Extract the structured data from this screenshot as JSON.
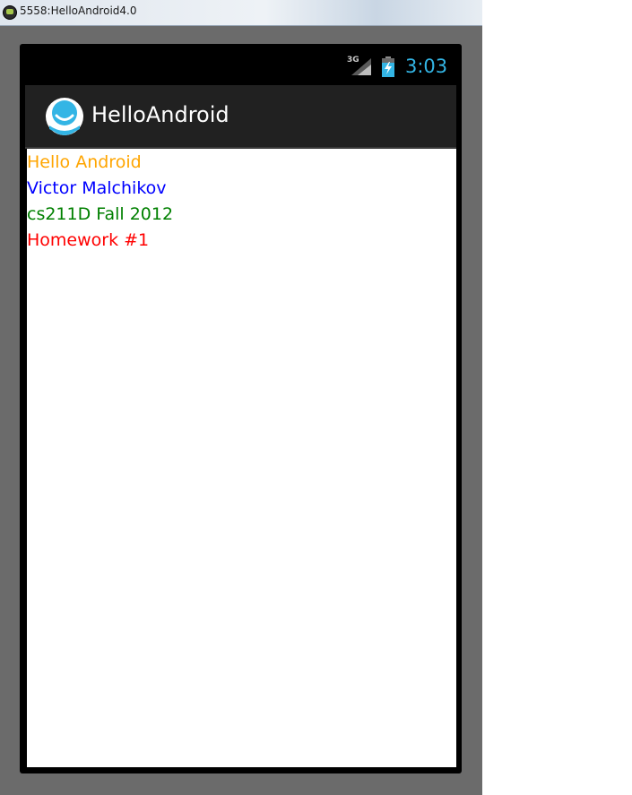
{
  "window": {
    "title": "5558:HelloAndroid4.0"
  },
  "status_bar": {
    "network_label": "3G",
    "clock": "3:03",
    "clock_color": "#33b5e5"
  },
  "action_bar": {
    "app_title": "HelloAndroid",
    "icon": "hello-android-app-icon"
  },
  "content": {
    "lines": [
      {
        "text": "Hello Android",
        "color": "#ffa500"
      },
      {
        "text": "Victor Malchikov",
        "color": "#0000ff"
      },
      {
        "text": "cs211D Fall 2012",
        "color": "#008000"
      },
      {
        "text": "Homework #1",
        "color": "#ff0000"
      }
    ]
  }
}
